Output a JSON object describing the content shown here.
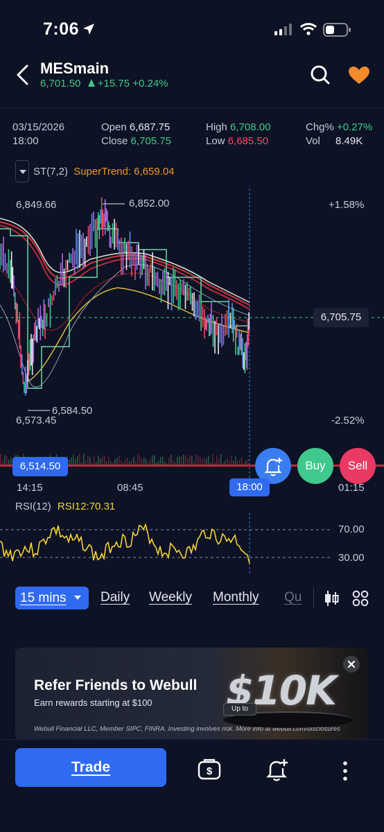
{
  "status_bar": {
    "time": "7:06"
  },
  "header": {
    "symbol": "MESmain",
    "last_price": "6,701.50",
    "change": "+15.75",
    "change_pct": "+0.24%"
  },
  "ohlc": {
    "date": "03/15/2026",
    "time": "18:00",
    "open_label": "Open",
    "open": "6,687.75",
    "close_label": "Close",
    "close": "6,705.75",
    "high_label": "High",
    "high": "6,708.00",
    "low_label": "Low",
    "low": "6,685.50",
    "chg_label": "Chg%",
    "chg": "+0.27%",
    "vol_label": "Vol",
    "vol": "8.49K"
  },
  "indicator": {
    "name": "ST(7,2)",
    "value_label": "SuperTrend: 6,659.04"
  },
  "chart": {
    "max_left": "6,849.66",
    "high_marker": "6,852.00",
    "low_marker": "6,584.50",
    "min_left": "6,573.45",
    "pct_top": "+1.58%",
    "pct_bottom": "-2.52%",
    "current_price": "6,705.75",
    "low_price_tag": "6,514.50",
    "time_labels": [
      "14:15",
      "08:45",
      "18:00",
      "01:15"
    ]
  },
  "actions": {
    "buy": "Buy",
    "sell": "Sell"
  },
  "rsi": {
    "name": "RSI(12)",
    "value_label": "RSI12:70.31",
    "upper": "70.00",
    "lower": "30.00"
  },
  "timeframes": {
    "active": "15 mins",
    "items": [
      "Daily",
      "Weekly",
      "Monthly",
      "Qu"
    ]
  },
  "banner": {
    "title": "Refer Friends to Webull",
    "subtitle": "Earn rewards starting at $100",
    "disclaimer": "Webull Financial LLC, Member SIPC, FINRA. Investing involves risk. More info at webull.com/disclosures",
    "badge_upto": "Up to",
    "badge_amount": "$10K"
  },
  "bottom": {
    "trade_label": "Trade"
  },
  "colors": {
    "background": "#0d1224",
    "accent": "#2f6af1",
    "up": "#3fc98c",
    "down": "#ef4a6c",
    "supertrend": "#f0962d",
    "rsi": "#f5d33a"
  }
}
